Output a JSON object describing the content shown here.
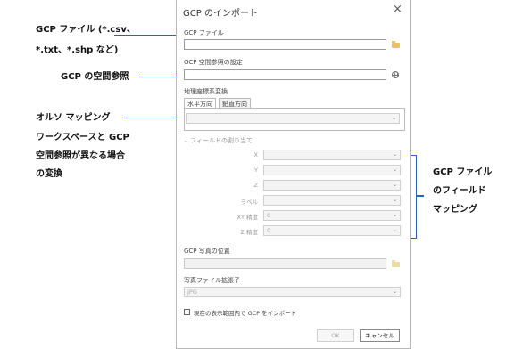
{
  "dialog": {
    "title": "GCP のインポート",
    "close_glyph": "×",
    "gcp_file_label": "GCP ファイル",
    "gcp_file_value": "",
    "sr_label": "GCP 空間参照の設定",
    "sr_value": "",
    "geo_transform_label": "地理座標系変換",
    "tabs": [
      "水平方向",
      "鉛直方向"
    ],
    "transform_value": "",
    "field_mapping_label": "フィールドの割り当て",
    "fields": [
      {
        "label": "X",
        "value": ""
      },
      {
        "label": "Y",
        "value": ""
      },
      {
        "label": "Z",
        "value": ""
      },
      {
        "label": "ラベル",
        "value": ""
      },
      {
        "label": "XY 精度",
        "value": "0"
      },
      {
        "label": "Z 精度",
        "value": "0"
      }
    ],
    "photo_location_label": "GCP 写真の位置",
    "photo_ext_label": "写真ファイル拡張子",
    "photo_ext_value": "JPG",
    "checkbox_label": "現在の表示範囲内で GCP をインポート",
    "ok_label": "OK",
    "cancel_label": "キャンセル"
  },
  "annotations": {
    "gcp_file_1": "GCP ファイル (*.csv、",
    "gcp_file_2": "*.txt、*.shp など)",
    "gcp_sr": "GCP の空間参照",
    "transform_1": "オルソ マッピング",
    "transform_2": "ワークスペースと GCP",
    "transform_3": "空間参照が異なる場合",
    "transform_4": "の変換",
    "mapping_1": "GCP ファイル",
    "mapping_2": "のフィールド",
    "mapping_3": "マッピング"
  },
  "colors": {
    "accent": "#2e62b8",
    "folder": "#e8c35a"
  }
}
